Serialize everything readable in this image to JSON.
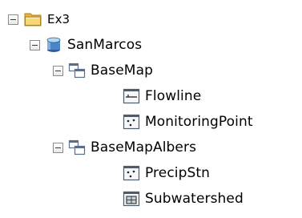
{
  "tree": {
    "root": {
      "label": "Ex3",
      "icon": "folder-icon",
      "expanded": true
    },
    "database": {
      "label": "SanMarcos",
      "icon": "geodatabase-icon",
      "expanded": true
    },
    "datasets": [
      {
        "label": "BaseMap",
        "icon": "feature-dataset-icon",
        "expanded": true,
        "classes": [
          {
            "label": "Flowline",
            "icon": "line-feature-class-icon"
          },
          {
            "label": "MonitoringPoint",
            "icon": "point-feature-class-icon"
          }
        ]
      },
      {
        "label": "BaseMapAlbers",
        "icon": "feature-dataset-icon",
        "expanded": true,
        "classes": [
          {
            "label": "PrecipStn",
            "icon": "point-feature-class-icon"
          },
          {
            "label": "Subwatershed",
            "icon": "polygon-feature-class-icon"
          }
        ]
      }
    ]
  },
  "colors": {
    "folder": "#f2cf5b",
    "database": "#4a86c8",
    "dataset": "#5a6f8c",
    "toggle_border": "#8c8c8c"
  }
}
